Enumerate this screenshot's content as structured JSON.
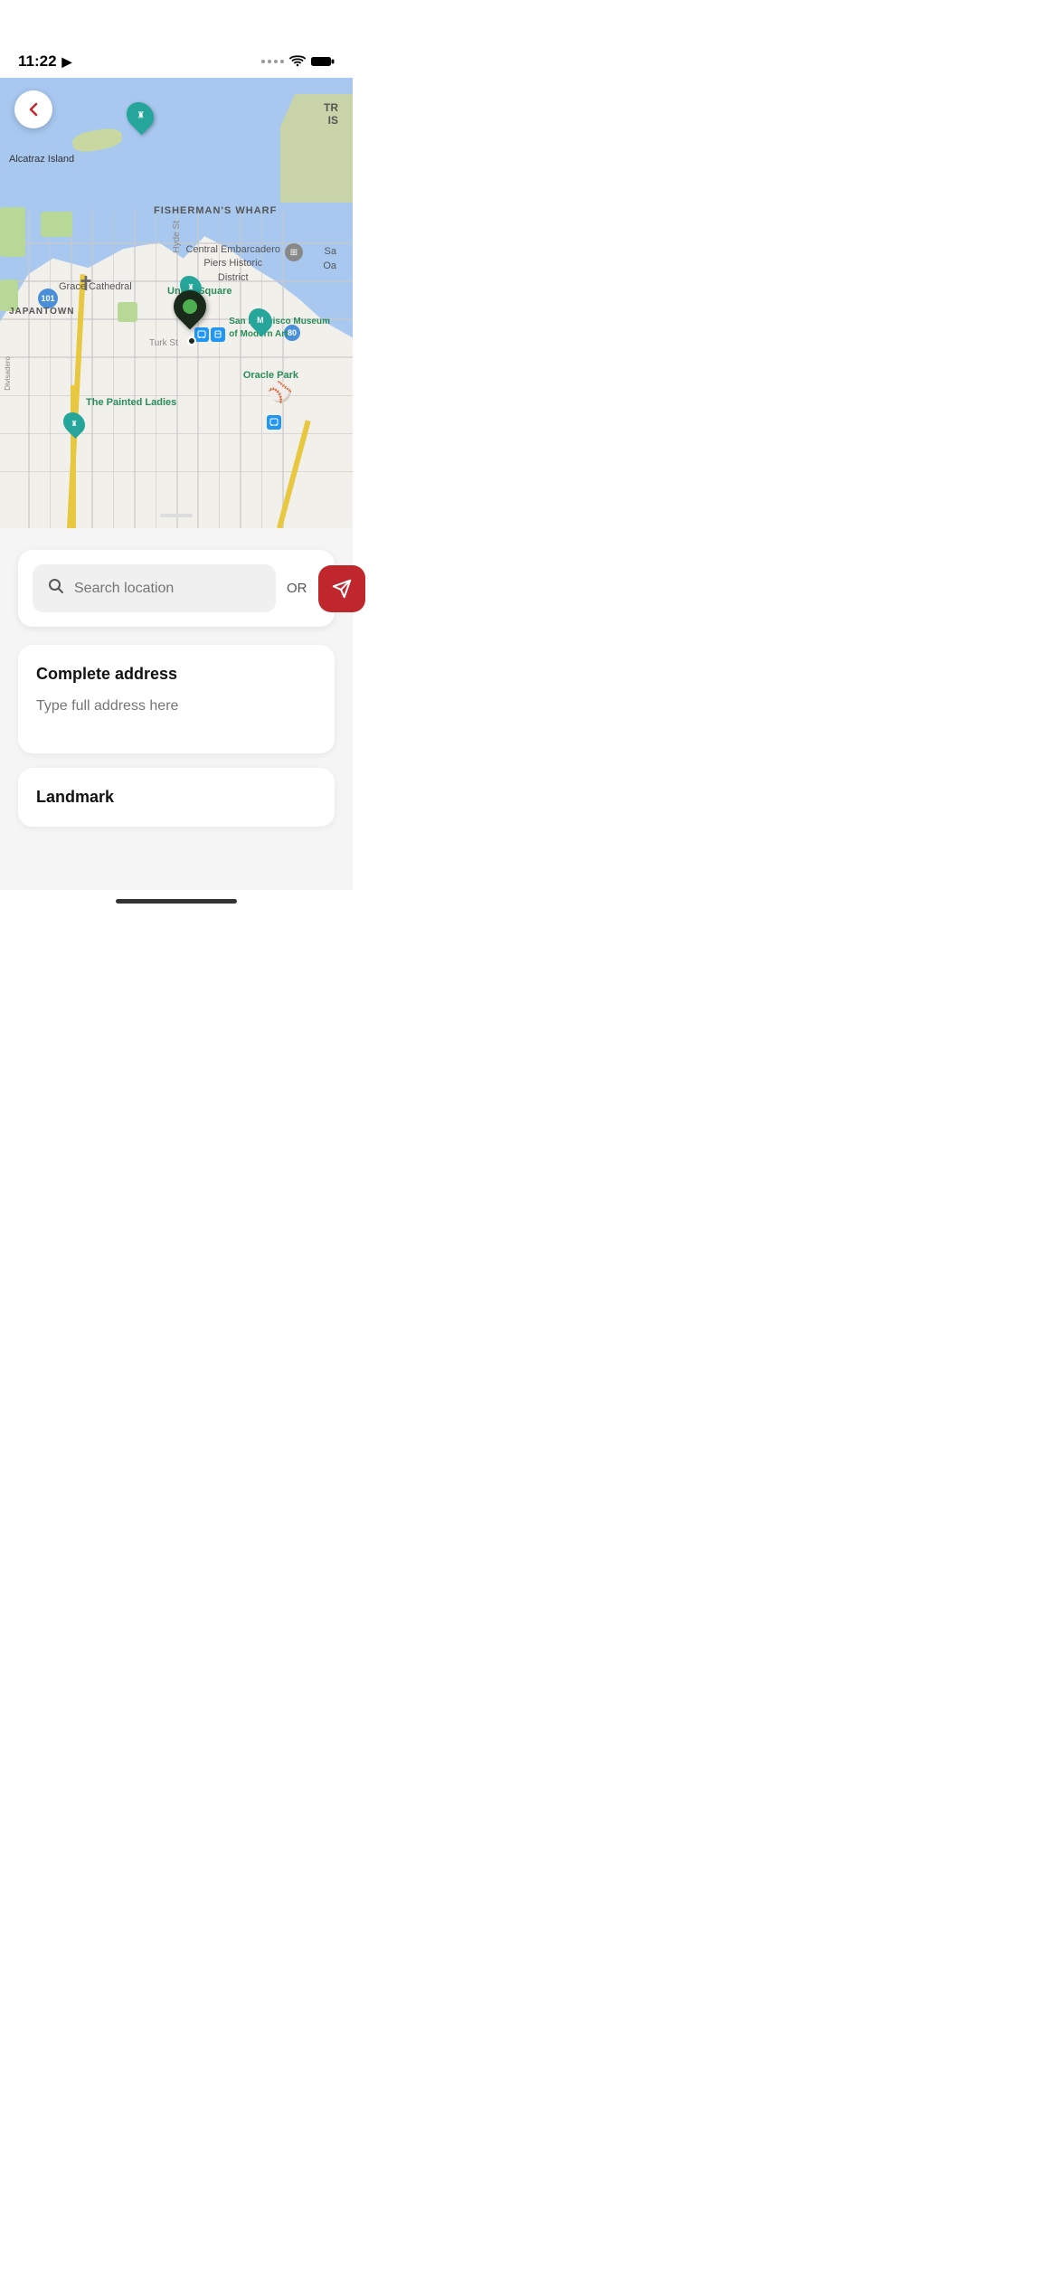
{
  "statusBar": {
    "time": "11:22",
    "hasNavArrow": true
  },
  "map": {
    "labels": {
      "alcatraz": "Alcatraz Island",
      "fishermansWharf": "FISHERMAN'S WHARF",
      "japantown": "JAPANTOWN",
      "graceCathedral": "Grace Cathedral",
      "unionSquare": "Union Square",
      "centralEmbarcadero": "Central Embarcadero",
      "piersHistoric": "Piers Historic",
      "district": "District",
      "sfMoma": "San Francisco Museum",
      "sfMoma2": "of Modern Art",
      "oraclePark": "Oracle Park",
      "paintedLadies": "The Painted Ladies",
      "turkSt": "Turk St",
      "hydeSt": "Hyde St",
      "highway101": "101",
      "highway80": "80",
      "sa": "Sa",
      "oa": "Oa",
      "tr": "TR",
      "is": "IS",
      "divisadero": "Divisadero"
    },
    "backButton": "←"
  },
  "search": {
    "placeholder": "Search location",
    "orText": "OR"
  },
  "addressCard": {
    "title": "Complete address",
    "inputPlaceholder": "Type full address here"
  },
  "landmarkCard": {
    "title": "Landmark"
  },
  "locationButton": {
    "icon": "▶"
  }
}
